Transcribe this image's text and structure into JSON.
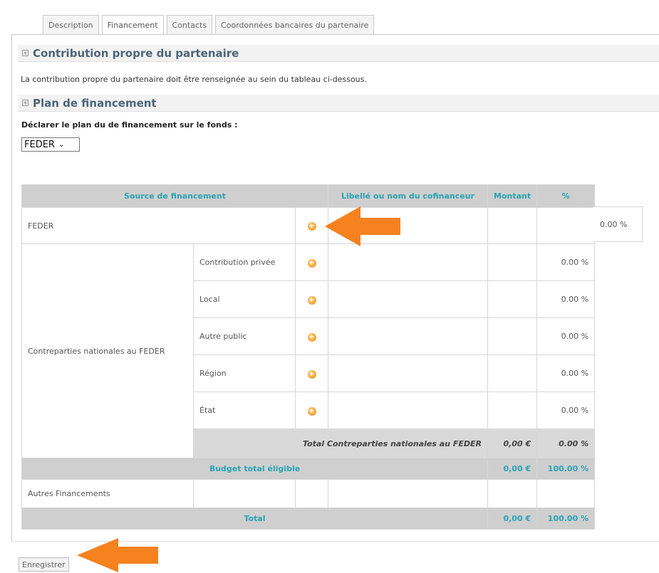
{
  "tabs": [
    {
      "label": "Description"
    },
    {
      "label": "Financement"
    },
    {
      "label": "Contacts"
    },
    {
      "label": "Coordonnées bancaires du partenaire"
    }
  ],
  "sections": {
    "contribution_title": "Contribution propre du partenaire",
    "contribution_text": "La contribution propre du partenaire doit être renseignée au sein du tableau ci-dessous.",
    "plan_title": "Plan de financement",
    "plan_label": "Déclarer le plan du de financement sur le fonds :",
    "fund_select": "FEDER"
  },
  "table": {
    "headers": {
      "source": "Source de financement",
      "libelle": "Libellé ou nom du cofinanceur",
      "montant": "Montant",
      "pct": "%"
    },
    "feder": {
      "label": "FEDER",
      "pct": "0.00 %"
    },
    "contreparties": {
      "label": "Contreparties nationales au FEDER",
      "rows": [
        {
          "label": "Contribution privée",
          "pct": "0.00 %"
        },
        {
          "label": "Local",
          "pct": "0.00 %"
        },
        {
          "label": "Autre public",
          "pct": "0.00 %"
        },
        {
          "label": "Région",
          "pct": "0.00 %"
        },
        {
          "label": "État",
          "pct": "0.00 %"
        }
      ],
      "total_label": "Total Contreparties nationales au FEDER",
      "total_amount": "0,00 €",
      "total_pct": "0.00 %"
    },
    "budget": {
      "label": "Budget total éligible",
      "amount": "0,00 €",
      "pct": "100.00 %"
    },
    "autres": {
      "label": "Autres Financements"
    },
    "total": {
      "label": "Total",
      "amount": "0,00 €",
      "pct": "100.00 %"
    }
  },
  "add_icon": "plus-circle-icon",
  "save_label": "Enregistrer",
  "colors": {
    "accent": "#2aa3b5",
    "arrow": "#f5821f",
    "header_bg": "#cfcfcf",
    "title": "#4d6478"
  }
}
